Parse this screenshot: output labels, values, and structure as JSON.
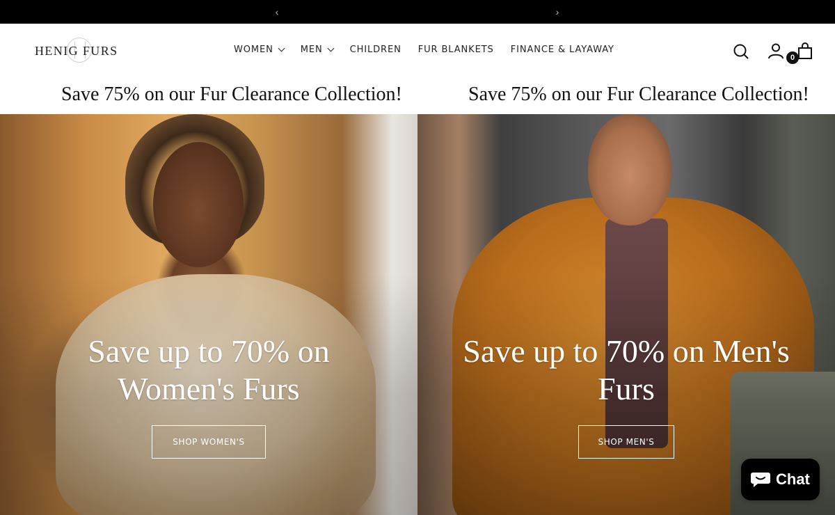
{
  "announcement": {
    "prev_arrow": "‹",
    "next_arrow": "›"
  },
  "header": {
    "logo_text": "HENIG FURS",
    "nav": [
      {
        "label": "WOMEN",
        "has_dropdown": true
      },
      {
        "label": "MEN",
        "has_dropdown": true
      },
      {
        "label": "CHILDREN",
        "has_dropdown": false
      },
      {
        "label": "FUR BLANKETS",
        "has_dropdown": false
      },
      {
        "label": "FINANCE & LAYAWAY",
        "has_dropdown": false
      }
    ],
    "icons": [
      "search-icon",
      "account-icon",
      "cart-icon"
    ],
    "cart_count": "0"
  },
  "marquee": {
    "messages": [
      "Save 75% on our Fur Clearance Collection!",
      "Save 75% on our Fur Clearance Collection!"
    ]
  },
  "hero": {
    "women": {
      "title_line1": "Save up to 70% on",
      "title_line2": "Women's Furs",
      "button": "SHOP WOMEN'S"
    },
    "men": {
      "title_line1": "Save up to 70% on Men's",
      "title_line2": "Furs",
      "button": "SHOP MEN'S"
    }
  },
  "chat": {
    "label": "Chat"
  },
  "colors": {
    "announcement_bg": "#000000",
    "text": "#111111",
    "chat_bg": "#000000"
  }
}
